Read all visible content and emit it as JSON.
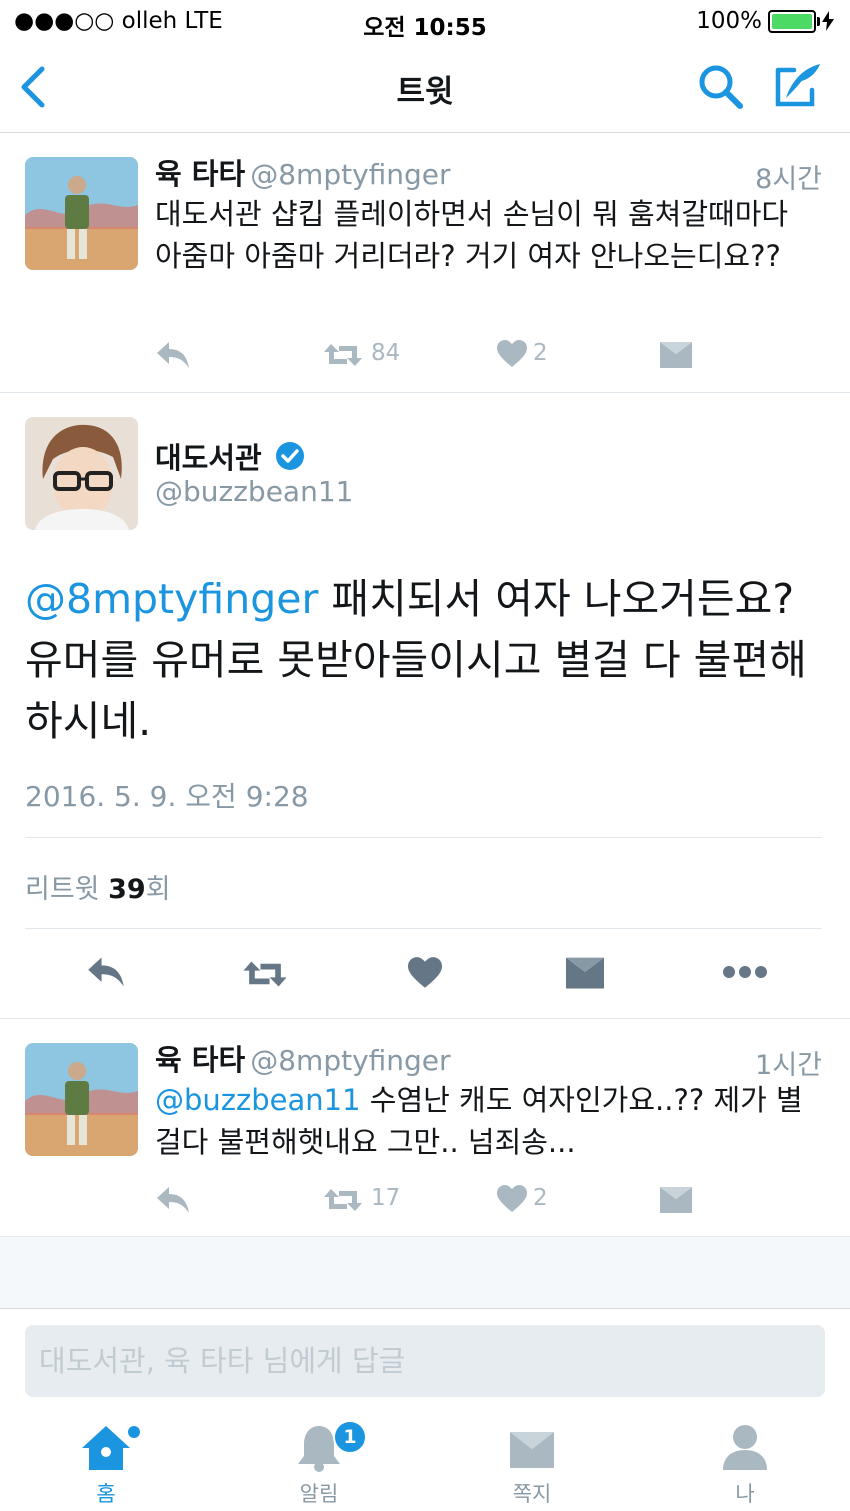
{
  "status_bar": {
    "carrier": "●●●○○ olleh   LTE",
    "time": "오전 10:55",
    "battery": "100%",
    "battery_level": 1.0
  },
  "nav": {
    "title": "트윗"
  },
  "tweet1": {
    "name": "육 타타",
    "handle": "@8mptyfinger",
    "time": "8시간",
    "text": "대도서관 샵킵 플레이하면서 손님이 뭐 훔쳐갈때마다 아줌마 아줌마 거리더라? 거기 여자 안나오는디요??",
    "retweets": "84",
    "likes": "2"
  },
  "main_tweet": {
    "name": "대도서관",
    "handle": "@buzzbean11",
    "mention": "@8mptyfinger",
    "text": " 패치되서 여자 나오거든요? 유머를 유머로 못받아들이시고 별걸 다  불편해 하시네.",
    "date": "2016. 5. 9. 오전 9:28",
    "retweet_label": "리트윗 ",
    "retweet_count": "39",
    "retweet_suffix": "회"
  },
  "tweet2": {
    "name": "육 타타",
    "handle": "@8mptyfinger",
    "time": "1시간",
    "mention": "@buzzbean11",
    "text": " 수염난 캐도 여자인가요..?? 제가 별걸다 불편해햇내요 그만.. 넘죄송...",
    "retweets": "17",
    "likes": "2"
  },
  "compose": {
    "placeholder": "대도서관, 육 타타 님에게 답글"
  },
  "tabs": [
    {
      "label": "홈"
    },
    {
      "label": "알림",
      "badge": "1"
    },
    {
      "label": "쪽지"
    },
    {
      "label": "나"
    }
  ],
  "colors": {
    "accent": "#1b95e0",
    "muted": "#8899a6",
    "action_gray": "#aab8c2"
  }
}
